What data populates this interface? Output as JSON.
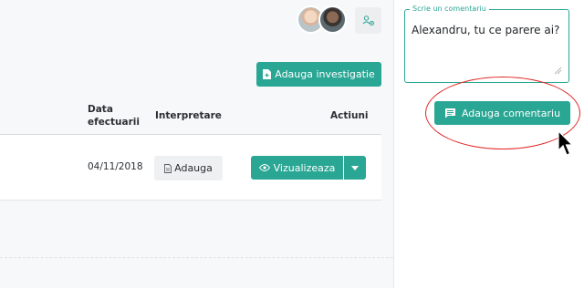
{
  "header": {
    "avatars": [
      {
        "name": "avatar-1"
      },
      {
        "name": "avatar-2"
      }
    ],
    "people_icon": "people-settings-icon"
  },
  "toolbar": {
    "add_investigation_label": "Adauga investigatie",
    "add_investigation_icon": "file-plus-icon"
  },
  "table": {
    "columns": {
      "date": "Data efectuarii",
      "interpretation": "Interpretare",
      "actions": "Actiuni"
    },
    "rows": [
      {
        "date": "04/11/2018",
        "interpretation_button": "Adauga",
        "view_button": "Vizualizeaza"
      }
    ]
  },
  "comment": {
    "legend": "Scrie un comentariu",
    "value": "Alexandru, tu ce parere ai?",
    "submit_label": "Adauga comentariu",
    "submit_icon": "comment-icon"
  },
  "colors": {
    "accent": "#2aa694",
    "highlight": "#e02424"
  }
}
